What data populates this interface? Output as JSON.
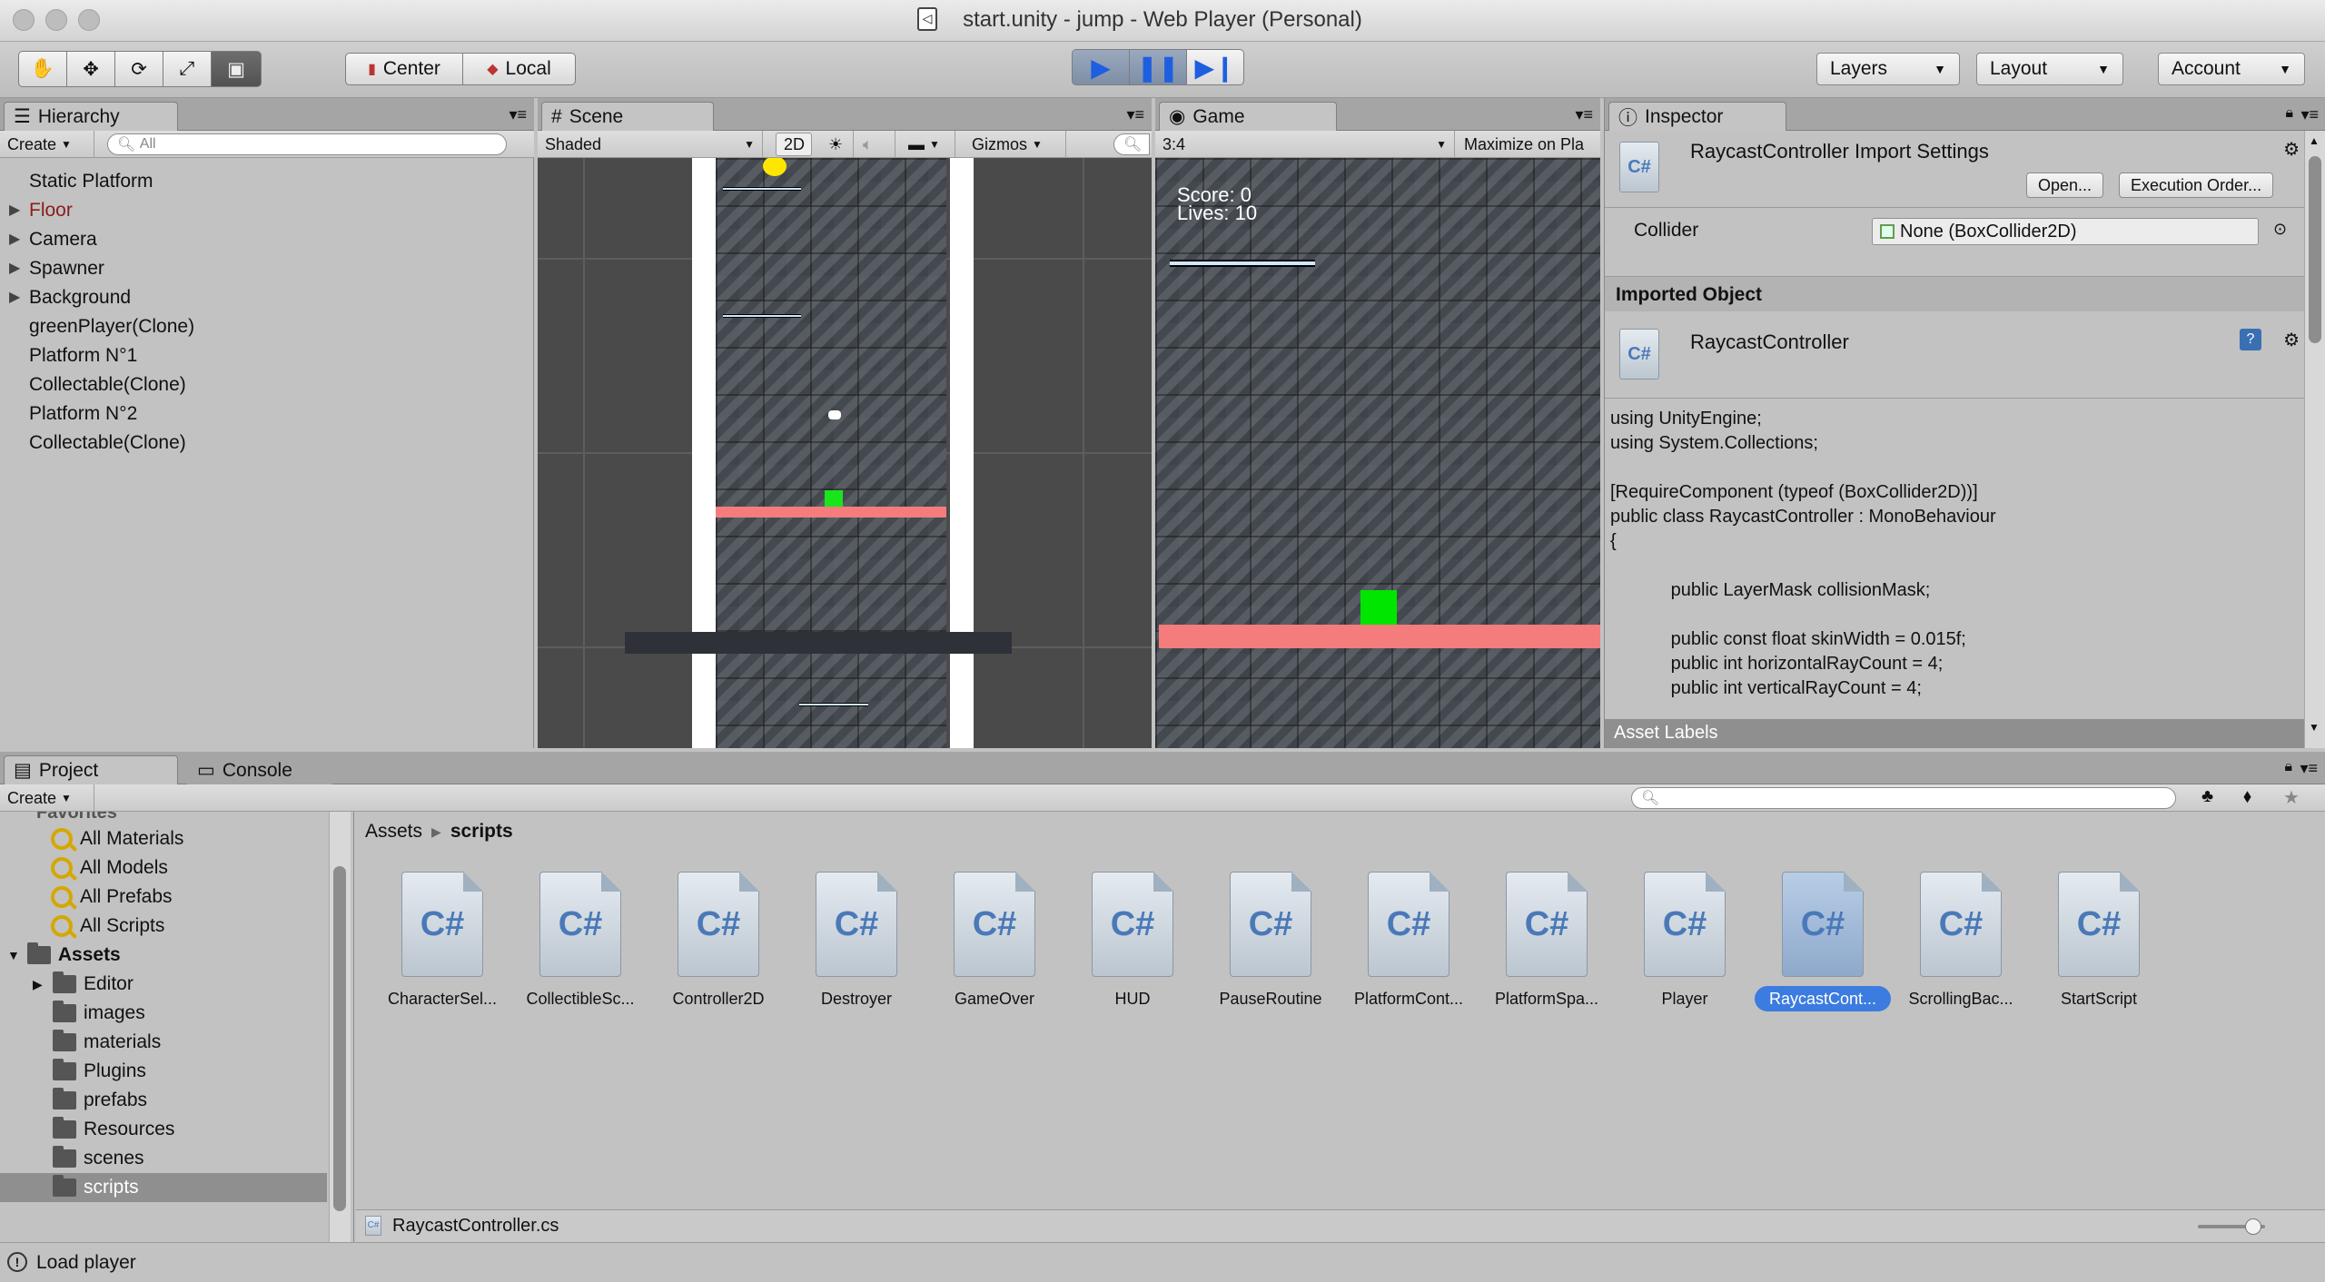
{
  "window": {
    "title": "start.unity - jump - Web Player (Personal)"
  },
  "toolbar": {
    "pivot_center": "Center",
    "pivot_local": "Local",
    "layers": "Layers",
    "layout": "Layout",
    "account": "Account"
  },
  "hierarchy": {
    "tab": "Hierarchy",
    "create": "Create",
    "search_placeholder": "All",
    "items": [
      {
        "label": "Static Platform",
        "expandable": false
      },
      {
        "label": "Floor",
        "expandable": true
      },
      {
        "label": "Camera",
        "expandable": true
      },
      {
        "label": "Spawner",
        "expandable": true
      },
      {
        "label": "Background",
        "expandable": true
      },
      {
        "label": "greenPlayer(Clone)",
        "expandable": false
      },
      {
        "label": "Platform N°1",
        "expandable": false
      },
      {
        "label": "Collectable(Clone)",
        "expandable": false
      },
      {
        "label": "Platform N°2",
        "expandable": false
      },
      {
        "label": "Collectable(Clone)",
        "expandable": false
      }
    ]
  },
  "scene": {
    "tab": "Scene",
    "shading": "Shaded",
    "mode_2d": "2D",
    "gizmos": "Gizmos"
  },
  "game": {
    "tab": "Game",
    "aspect": "3:4",
    "maximize": "Maximize on Pla",
    "score": "Score: 0",
    "lives": "Lives: 10"
  },
  "inspector": {
    "tab": "Inspector",
    "title": "RaycastController Import Settings",
    "open_btn": "Open...",
    "exec_order_btn": "Execution Order...",
    "collider_label": "Collider",
    "collider_value": "None (BoxCollider2D)",
    "imported_object": "Imported Object",
    "object_name": "RaycastController",
    "code": [
      "using UnityEngine;",
      "using System.Collections;",
      "",
      "[RequireComponent (typeof (BoxCollider2D))]",
      "public class RaycastController : MonoBehaviour",
      "{",
      "",
      "            public LayerMask collisionMask;",
      "",
      "            public const float skinWidth = 0.015f;",
      "            public int horizontalRayCount = 4;",
      "            public int verticalRayCount = 4;"
    ],
    "asset_labels": "Asset Labels"
  },
  "project": {
    "tab": "Project",
    "console_tab": "Console",
    "create": "Create",
    "favorites_label": "Favorites",
    "favorites": [
      "All Materials",
      "All Models",
      "All Prefabs",
      "All Scripts"
    ],
    "assets_label": "Assets",
    "folders": [
      "Editor",
      "images",
      "materials",
      "Plugins",
      "prefabs",
      "Resources",
      "scenes",
      "scripts"
    ],
    "breadcrumb_root": "Assets",
    "breadcrumb_current": "scripts",
    "assets": [
      "CharacterSel...",
      "CollectibleSc...",
      "Controller2D",
      "Destroyer",
      "GameOver",
      "HUD",
      "PauseRoutine",
      "PlatformCont...",
      "PlatformSpa...",
      "Player",
      "RaycastCont...",
      "ScrollingBac...",
      "StartScript"
    ],
    "selected_asset_index": 10,
    "selected_file": "RaycastController.cs",
    "icon_glyph": "C#"
  },
  "status": {
    "message": "Load player"
  }
}
